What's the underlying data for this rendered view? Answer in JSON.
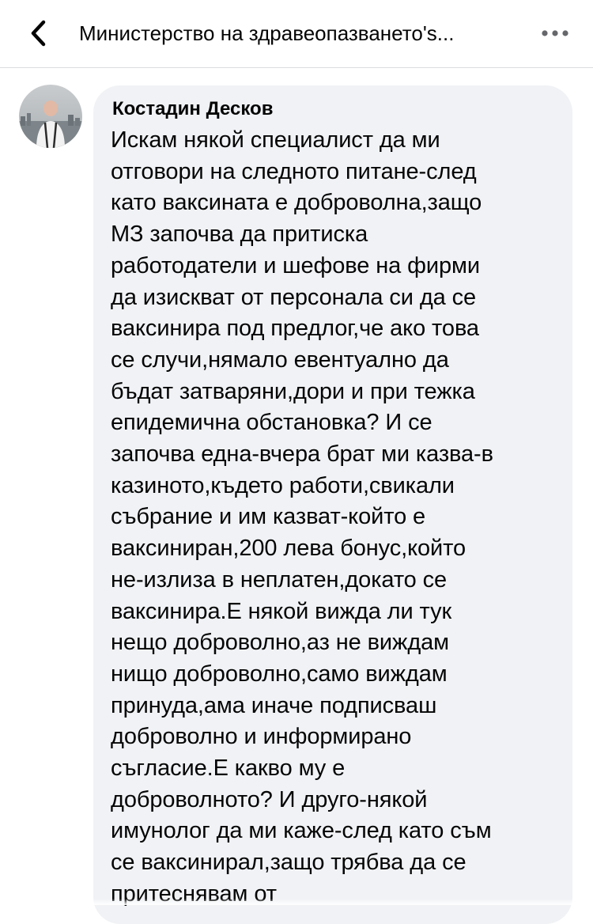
{
  "header": {
    "back_icon": "chevron-left-icon",
    "title": "Министерство на здравеопазването's...",
    "more_icon": "ellipsis-icon"
  },
  "comment": {
    "author": "Костадин Десков",
    "avatar_icon": "user-avatar",
    "lines": [
      "Искам някой специалист да ми",
      "отговори на следното питане-след",
      "като ваксината е доброволна,защо",
      "МЗ започва да притиска",
      "работодатели и шефове на фирми",
      "да изискват от персонала си да се",
      "ваксинира под предлог,че ако това",
      "се случи,нямало евентуално да",
      "бъдат затваряни,дори и при тежка",
      "епидемична обстановка? И се",
      "започва една-вчера брат ми казва-в",
      "казиното,където работи,свикали",
      "събрание и им казват-който е",
      "ваксиниран,200 лева бонус,който",
      "не-излиза в неплатен,докато се",
      "ваксинира.Е някой вижда ли тук",
      "нещо доброволно,аз не виждам",
      "нищо доброволно,само виждам",
      "принуда,ама иначе подписваш",
      "доброволно и информирано",
      "съгласие.Е какво му е",
      "доброволното? И друго-някой",
      "имунолог да ми каже-след като съм",
      "се ваксинирал,защо трябва да се",
      "притеснявам от"
    ]
  },
  "colors": {
    "bubble_bg": "#f0f2f5",
    "text": "#050505",
    "divider": "#dcdde0"
  }
}
